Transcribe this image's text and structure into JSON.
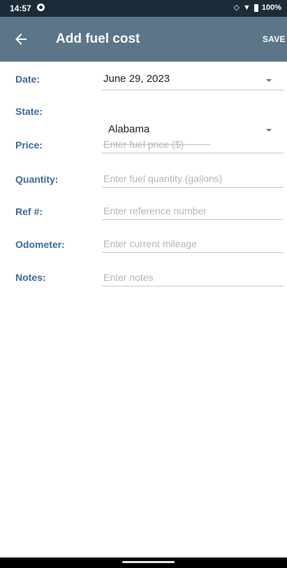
{
  "status_bar": {
    "time": "14:57",
    "battery": "100%",
    "icons": [
      "app-notification-icon",
      "cast-icon",
      "wifi-icon",
      "battery-icon"
    ]
  },
  "app_bar": {
    "title": "Add fuel cost",
    "save_label": "SAVE",
    "back_icon": "arrow-left-icon",
    "color": "#5b7688"
  },
  "form": {
    "date": {
      "label": "Date:",
      "value": "June 29, 2023"
    },
    "state": {
      "label": "State:",
      "value": "Alabama"
    },
    "price": {
      "label": "Price:",
      "placeholder": "Enter fuel price ($)"
    },
    "quantity": {
      "label": "Quantity:",
      "placeholder": "Enter fuel quantity (gallons)"
    },
    "ref": {
      "label": "Ref #:",
      "placeholder": "Enter reference number"
    },
    "odometer": {
      "label": "Odometer:",
      "placeholder": "Enter current mileage"
    },
    "notes": {
      "label": "Notes:",
      "placeholder": "Enter notes"
    },
    "label_color": "#3d6a9a"
  }
}
